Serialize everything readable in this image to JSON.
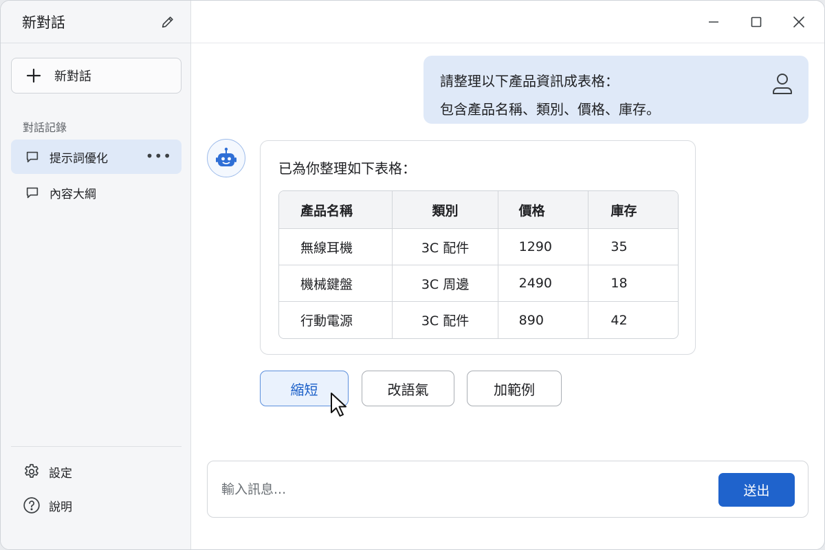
{
  "sidebar": {
    "title": "新對話",
    "new_chat_label": "新對話",
    "history_label": "對話記錄",
    "items": [
      {
        "label": "提示詞優化",
        "more": "•••"
      },
      {
        "label": "內容大綱"
      }
    ],
    "settings_label": "設定",
    "help_label": "說明"
  },
  "chat": {
    "user_message": {
      "line1": "請整理以下產品資訊成表格：",
      "line2": "包含產品名稱、類別、價格、庫存。"
    },
    "bot_message": {
      "intro": "已為你整理如下表格：",
      "table": {
        "headers": [
          "產品名稱",
          "類別",
          "價格",
          "庫存"
        ],
        "rows": [
          [
            "無線耳機",
            "3C 配件",
            "1290",
            "35"
          ],
          [
            "機械鍵盤",
            "3C 周邊",
            "2490",
            "18"
          ],
          [
            "行動電源",
            "3C 配件",
            "890",
            "42"
          ]
        ]
      }
    },
    "actions": [
      "縮短",
      "改語氣",
      "加範例"
    ]
  },
  "composer": {
    "placeholder": "輸入訊息...",
    "send_label": "送出"
  },
  "colors": {
    "accent": "#1f63cc",
    "bubble": "#dfe9f8",
    "active_item": "#dfe9f8"
  }
}
